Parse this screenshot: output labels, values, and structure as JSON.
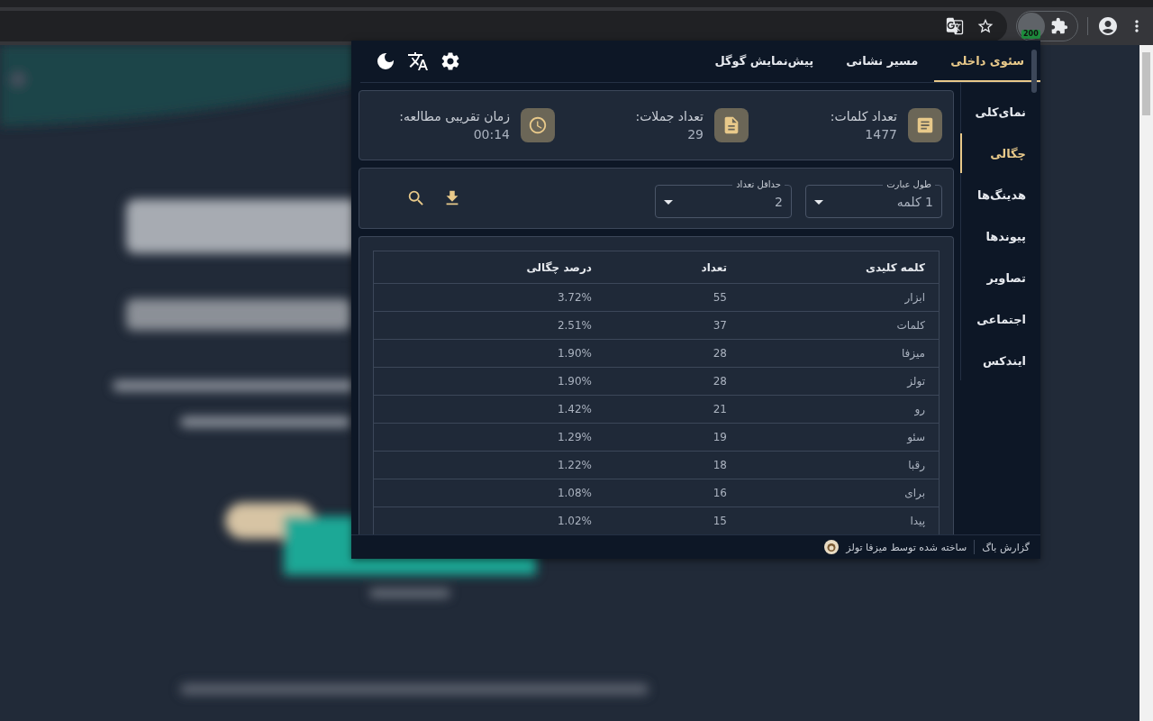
{
  "browser": {
    "extension_badge": "200"
  },
  "popup": {
    "tabs": [
      {
        "label": "سئوی داخلی",
        "selected": true
      },
      {
        "label": "مسیر نشانی",
        "selected": false
      },
      {
        "label": "پیش‌نمایش گوگل",
        "selected": false
      }
    ],
    "sidebar": [
      {
        "label": "نمای‌کلی",
        "selected": false
      },
      {
        "label": "چگالی",
        "selected": true
      },
      {
        "label": "هدینگ‌ها",
        "selected": false
      },
      {
        "label": "پیوندها",
        "selected": false
      },
      {
        "label": "تصاویر",
        "selected": false
      },
      {
        "label": "اجتماعی",
        "selected": false
      },
      {
        "label": "ایندکس",
        "selected": false
      }
    ],
    "stats": [
      {
        "kind": "words",
        "label": "تعداد کلمات:",
        "value": "1477"
      },
      {
        "kind": "sentences",
        "label": "تعداد جملات:",
        "value": "29"
      },
      {
        "kind": "time",
        "label": "زمان تقریبی مطالعه:",
        "value": "00:14"
      }
    ],
    "filters": [
      {
        "label": "طول عبارت",
        "value": "1 کلمه"
      },
      {
        "label": "حداقل تعداد",
        "value": "2"
      }
    ],
    "table": {
      "columns": [
        "کلمه کلیدی",
        "تعداد",
        "درصد چگالی"
      ],
      "rows": [
        [
          "ابزار",
          "55",
          "3.72%"
        ],
        [
          "کلمات",
          "37",
          "2.51%"
        ],
        [
          "میزفا",
          "28",
          "1.90%"
        ],
        [
          "تولز",
          "28",
          "1.90%"
        ],
        [
          "رو",
          "21",
          "1.42%"
        ],
        [
          "سئو",
          "19",
          "1.29%"
        ],
        [
          "رقبا",
          "18",
          "1.22%"
        ],
        [
          "برای",
          "16",
          "1.08%"
        ],
        [
          "پیدا",
          "15",
          "1.02%"
        ]
      ]
    },
    "footer": {
      "bug_report": "گزارش باگ",
      "credit": "ساخته شده توسط میزفا تولز"
    }
  }
}
